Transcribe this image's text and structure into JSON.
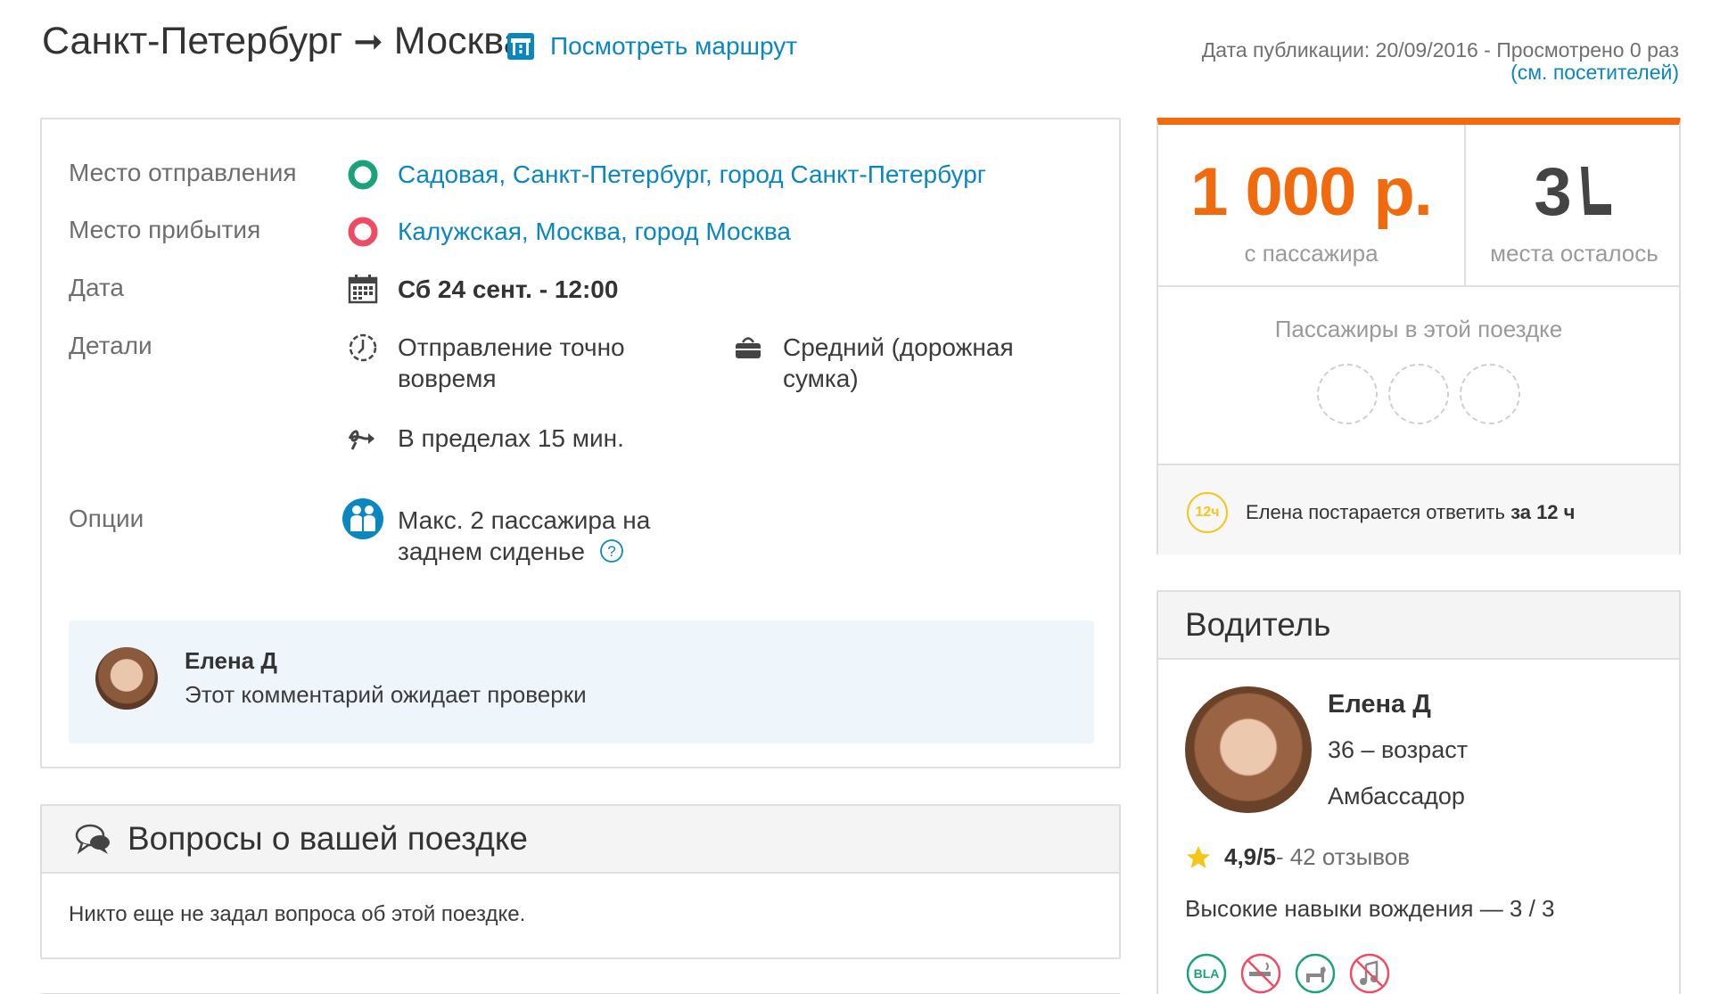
{
  "header": {
    "from_city": "Санкт-Петербург",
    "arrow": "➞",
    "to_city": "Москва",
    "route_link": "Посмотреть маршрут",
    "publication": "Дата публикации: 20/09/2016 - Просмотрено 0 раз",
    "visitors_link": "(см. посетителей)"
  },
  "trip": {
    "departure_label": "Место отправления",
    "departure_value": "Садовая, Санкт-Петербург, город Санкт-Петербург",
    "arrival_label": "Место прибытия",
    "arrival_value": "Калужская, Москва, город Москва",
    "date_label": "Дата",
    "date_value": "Сб 24 сент. - 12:00",
    "details_label": "Детали",
    "punctuality": "Отправление точно вовремя",
    "luggage": "Средний (дорожная сумка)",
    "detour": "В пределах 15 мин.",
    "options_label": "Опции",
    "options_value": "Макс. 2 пассажира на заднем сиденье",
    "help_icon": "?"
  },
  "comment": {
    "author": "Елена Д",
    "text": "Этот комментарий ожидает проверки"
  },
  "questions": {
    "title": "Вопросы о вашей поездке",
    "empty_text": "Никто еще не задал вопроса об этой поездке."
  },
  "booking": {
    "price": "1 000 р.",
    "price_sub": "с пассажира",
    "seats": "3",
    "seats_sub": "места осталось",
    "passengers_title": "Пассажиры в этой поездке",
    "reply_badge": "12ч",
    "reply_text": "Елена постарается ответить ",
    "reply_time": "за 12 ч"
  },
  "driver": {
    "section_title": "Водитель",
    "name": "Елена Д",
    "age": "36 – возраст",
    "level": "Амбассадор",
    "rating": "4,9/5",
    "reviews": " - 42 отзывов",
    "skill": "Высокие навыки вождения — 3 / 3",
    "preferences": [
      "bla-icon",
      "no-smoking-icon",
      "pets-icon",
      "no-music-icon"
    ]
  },
  "colors": {
    "accent": "#f26a0e",
    "link": "#0a86c0",
    "departure": "#1aa37a",
    "arrival": "#ef4b63",
    "reply_badge": "#f5c518"
  }
}
